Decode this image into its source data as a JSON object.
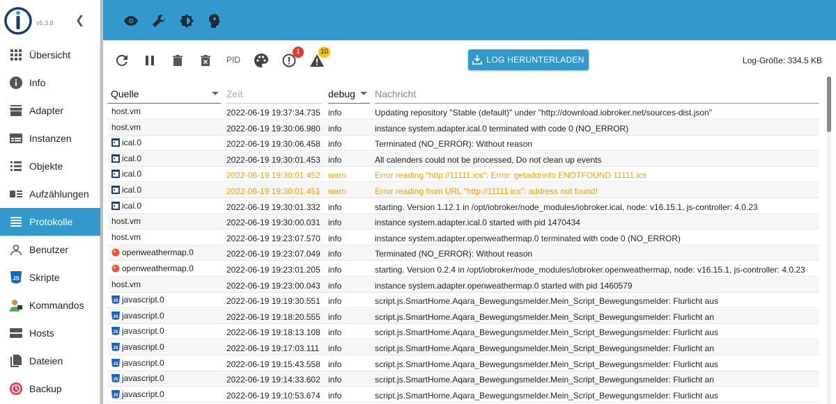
{
  "brand": {
    "version": "v5.3.8"
  },
  "sidebar": {
    "items": [
      {
        "label": "Übersicht",
        "icon": "apps-icon"
      },
      {
        "label": "Info",
        "icon": "info-icon"
      },
      {
        "label": "Adapter",
        "icon": "store-icon"
      },
      {
        "label": "Instanzen",
        "icon": "instances-icon"
      },
      {
        "label": "Objekte",
        "icon": "list-icon"
      },
      {
        "label": "Aufzählungen",
        "icon": "enum-icon"
      },
      {
        "label": "Protokolle",
        "icon": "log-icon",
        "active": true
      },
      {
        "label": "Benutzer",
        "icon": "user-icon"
      },
      {
        "label": "Skripte",
        "icon": "js-icon"
      },
      {
        "label": "Kommandos",
        "icon": "commands-icon"
      },
      {
        "label": "Hosts",
        "icon": "hosts-icon"
      },
      {
        "label": "Dateien",
        "icon": "files-icon"
      },
      {
        "label": "Backup",
        "icon": "backup-icon"
      }
    ]
  },
  "topbar": {
    "icons": [
      "eye-icon",
      "wrench-icon",
      "brightness-icon",
      "expert-mode-icon"
    ]
  },
  "toolbar": {
    "pid_label": "PID",
    "error_count": "1",
    "warn_count": "10",
    "download_label": "LOG HERUNTERLADEN",
    "log_size": "Log-Größe: 334.5 KB"
  },
  "table": {
    "headers": {
      "source": "Quelle",
      "time": "Zeit",
      "severity": "debug",
      "message": "Nachricht"
    },
    "rows": [
      {
        "source": "host.vm",
        "type": "host",
        "time": "2022-06-19 19:37:34.735",
        "severity": "info",
        "message": "Updating repository \"Stable (default)\" under \"http://download.iobroker.net/sources-dist.json\""
      },
      {
        "source": "host.vm",
        "type": "host",
        "time": "2022-06-19 19:30:06.980",
        "severity": "info",
        "message": "instance system.adapter.ical.0 terminated with code 0 (NO_ERROR)"
      },
      {
        "source": "ical.0",
        "type": "ical",
        "time": "2022-06-19 19:30:06.458",
        "severity": "info",
        "message": "Terminated (NO_ERROR): Without reason"
      },
      {
        "source": "ical.0",
        "type": "ical",
        "time": "2022-06-19 19:30:01.453",
        "severity": "info",
        "message": "All calenders could not be processed, Do not clean up events"
      },
      {
        "source": "ical.0",
        "type": "ical",
        "time": "2022-06-19 19:30:01.452",
        "severity": "warn",
        "message": "Error reading \"http://11111.ics\": Error: getaddrinfo ENOTFOUND 11111.ics"
      },
      {
        "source": "ical.0",
        "type": "ical",
        "time": "2022-06-19 19:30:01.451",
        "severity": "warn",
        "message": "Error reading from URL \"http://11111.ics\": address not found!"
      },
      {
        "source": "ical.0",
        "type": "ical",
        "time": "2022-06-19 19:30:01.332",
        "severity": "info",
        "message": "starting. Version 1.12.1 in /opt/iobroker/node_modules/iobroker.ical, node: v16.15.1, js-controller: 4.0.23"
      },
      {
        "source": "host.vm",
        "type": "host",
        "time": "2022-06-19 19:30:00.031",
        "severity": "info",
        "message": "instance system.adapter.ical.0 started with pid 1470434"
      },
      {
        "source": "host.vm",
        "type": "host",
        "time": "2022-06-19 19:23:07.570",
        "severity": "info",
        "message": "instance system.adapter.openweathermap.0 terminated with code 0 (NO_ERROR)"
      },
      {
        "source": "openweathermap.0",
        "type": "weather",
        "time": "2022-06-19 19:23:07.049",
        "severity": "info",
        "message": "Terminated (NO_ERROR): Without reason"
      },
      {
        "source": "openweathermap.0",
        "type": "weather",
        "time": "2022-06-19 19:23:01.205",
        "severity": "info",
        "message": "starting. Version 0.2.4 in /opt/iobroker/node_modules/iobroker.openweathermap, node: v16.15.1, js-controller: 4.0.23"
      },
      {
        "source": "host.vm",
        "type": "host",
        "time": "2022-06-19 19:23:00.043",
        "severity": "info",
        "message": "instance system.adapter.openweathermap.0 started with pid 1460579"
      },
      {
        "source": "javascript.0",
        "type": "js",
        "time": "2022-06-19 19:19:30.551",
        "severity": "info",
        "message": "script.js.SmartHome.Aqara_Bewegungsmelder.Mein_Script_Bewegungsmelder: Flurlicht aus"
      },
      {
        "source": "javascript.0",
        "type": "js",
        "time": "2022-06-19 19:18:20.555",
        "severity": "info",
        "message": "script.js.SmartHome.Aqara_Bewegungsmelder.Mein_Script_Bewegungsmelder: Flurlicht an"
      },
      {
        "source": "javascript.0",
        "type": "js",
        "time": "2022-06-19 19:18:13.108",
        "severity": "info",
        "message": "script.js.SmartHome.Aqara_Bewegungsmelder.Mein_Script_Bewegungsmelder: Flurlicht aus"
      },
      {
        "source": "javascript.0",
        "type": "js",
        "time": "2022-06-19 19:17:03.111",
        "severity": "info",
        "message": "script.js.SmartHome.Aqara_Bewegungsmelder.Mein_Script_Bewegungsmelder: Flurlicht an"
      },
      {
        "source": "javascript.0",
        "type": "js",
        "time": "2022-06-19 19:15:43.558",
        "severity": "info",
        "message": "script.js.SmartHome.Aqara_Bewegungsmelder.Mein_Script_Bewegungsmelder: Flurlicht aus"
      },
      {
        "source": "javascript.0",
        "type": "js",
        "time": "2022-06-19 19:14:33.602",
        "severity": "info",
        "message": "script.js.SmartHome.Aqara_Bewegungsmelder.Mein_Script_Bewegungsmelder: Flurlicht an"
      },
      {
        "source": "javascript.0",
        "type": "js",
        "time": "2022-06-19 19:10:53.674",
        "severity": "info",
        "message": "script.js.SmartHome.Aqara_Bewegungsmelder.Mein_Script_Bewegungsmelder: Flurlicht aus"
      }
    ]
  },
  "colors": {
    "accent": "#3399cc",
    "warn": "#f5a100",
    "error_badge": "#e53935",
    "warn_badge": "#ffc107"
  }
}
